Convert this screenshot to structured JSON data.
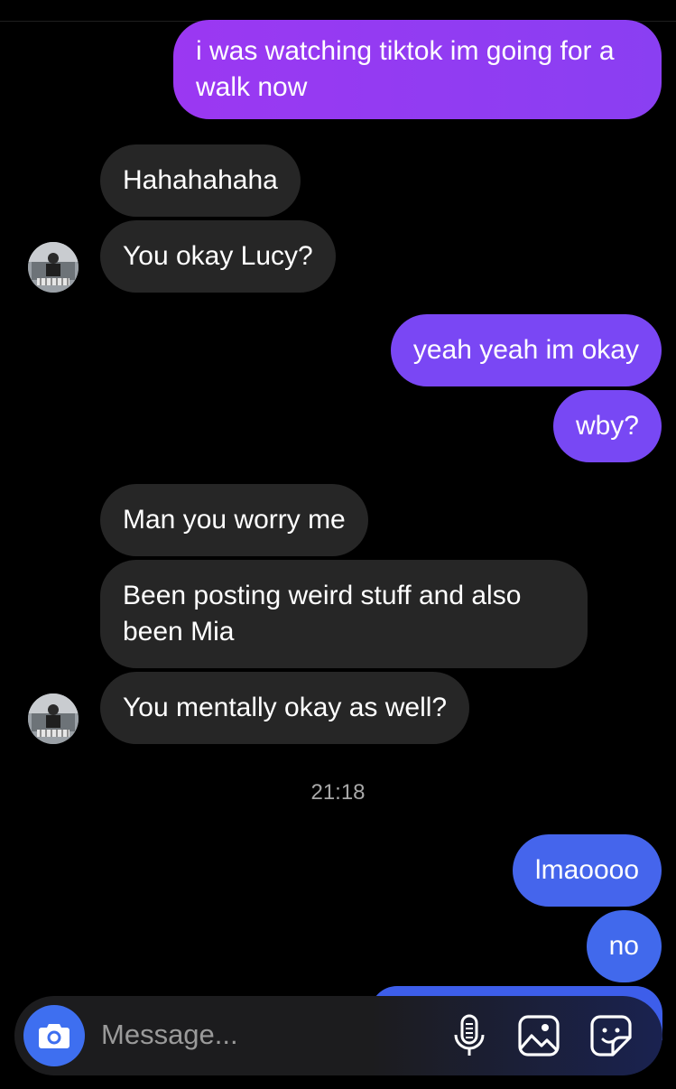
{
  "conversation": {
    "messages": [
      {
        "direction": "sent",
        "text": "i was watching tiktok im going for a walk now",
        "color": "#8a3ff2"
      },
      {
        "direction": "received",
        "text": "Hahahahaha"
      },
      {
        "direction": "received",
        "text": "You okay Lucy?"
      },
      {
        "direction": "sent",
        "text": "yeah yeah im okay",
        "color": "#7a47f4"
      },
      {
        "direction": "sent",
        "text": "wby?",
        "color": "#7a47f4"
      },
      {
        "direction": "received",
        "text": "Man you worry me"
      },
      {
        "direction": "received",
        "text": "Been posting weird stuff and also been Mia"
      },
      {
        "direction": "received",
        "text": "You mentally okay as well?"
      },
      {
        "direction": "sent",
        "text": "lmaoooo",
        "color": "#4565ec"
      },
      {
        "direction": "sent",
        "text": "no",
        "color": "#4169ec"
      }
    ],
    "timestamp": "21:18"
  },
  "composer": {
    "placeholder": "Message...",
    "icons": [
      "camera-icon",
      "microphone-icon",
      "gallery-icon",
      "sticker-icon"
    ],
    "accent": "#3e6ff0"
  }
}
